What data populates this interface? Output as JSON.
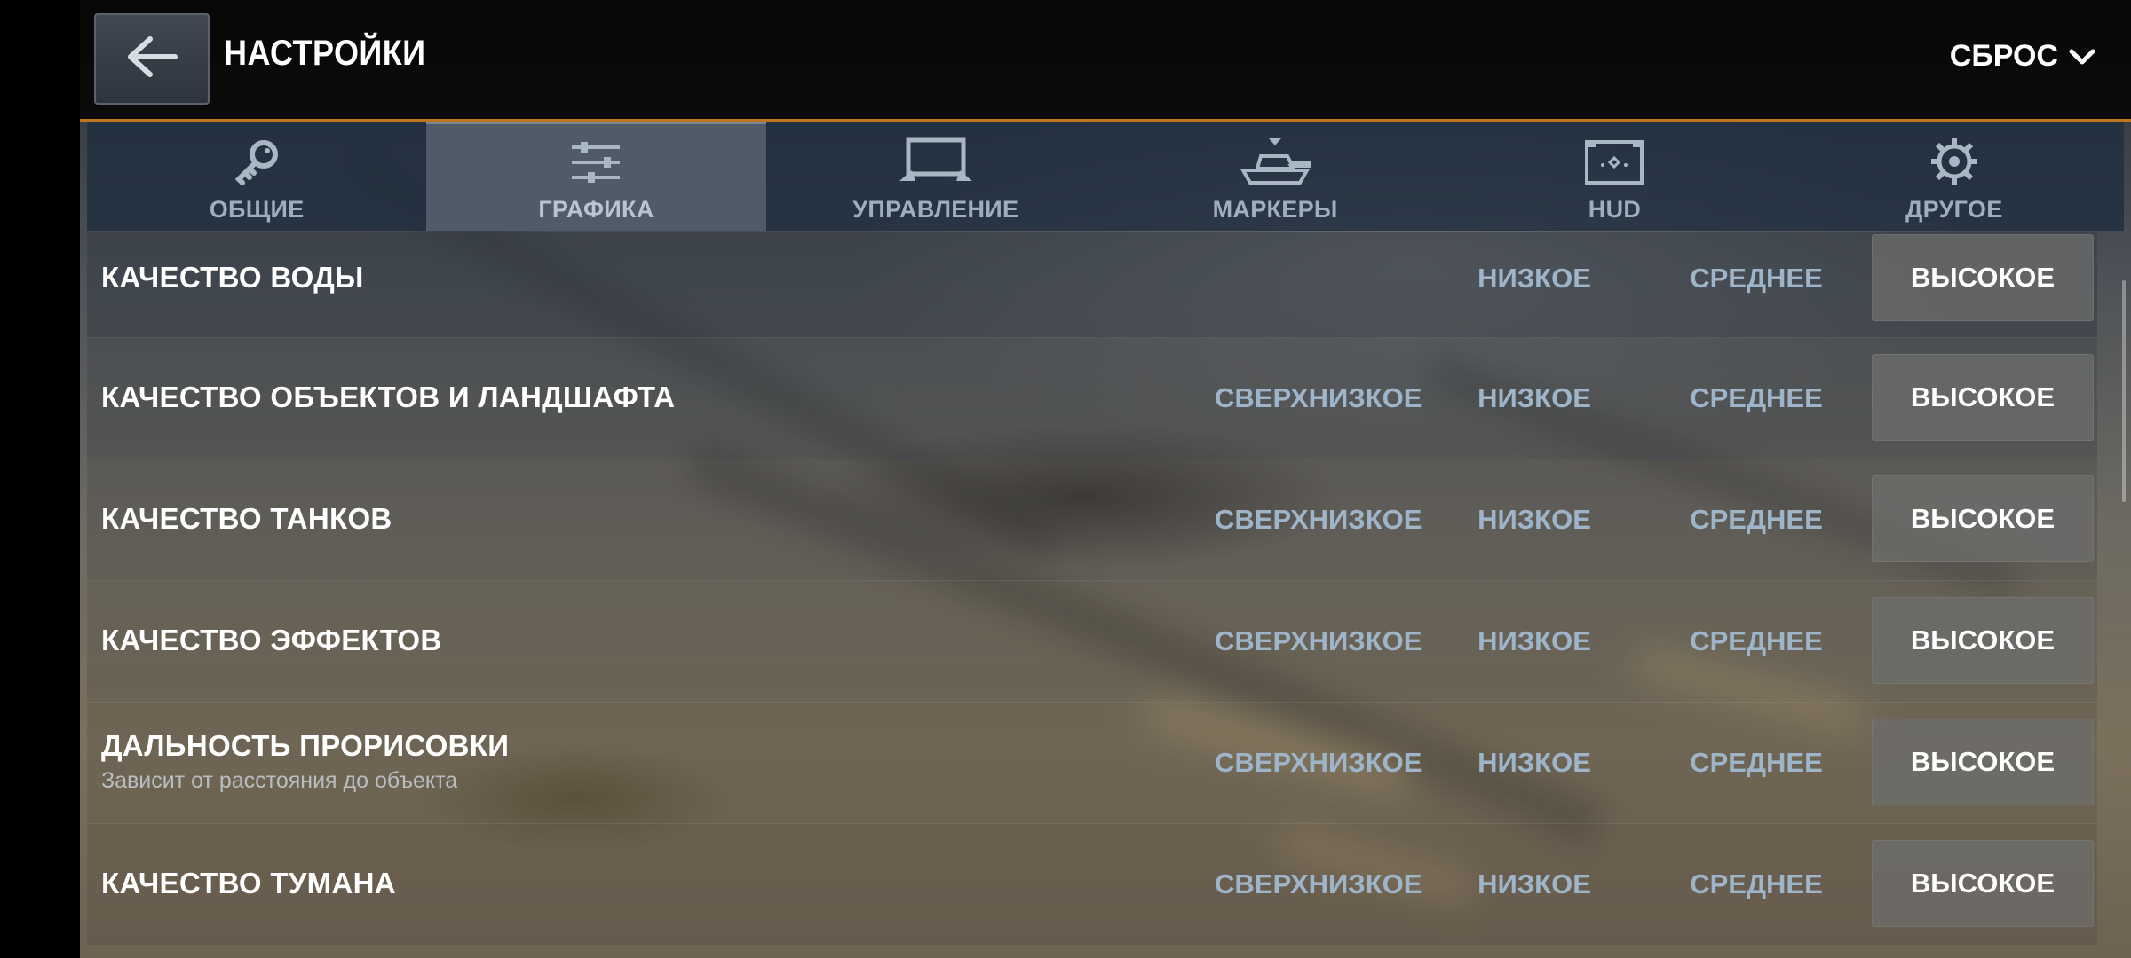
{
  "header": {
    "title": "НАСТРОЙКИ",
    "reset_label": "СБРОС",
    "accent_color": "#c0741c"
  },
  "tabs": [
    {
      "label": "ОБЩИЕ",
      "icon": "key-icon",
      "active": false
    },
    {
      "label": "ГРАФИКА",
      "icon": "sliders-icon",
      "active": true
    },
    {
      "label": "УПРАВЛЕНИЕ",
      "icon": "controller-icon",
      "active": false
    },
    {
      "label": "МАРКЕРЫ",
      "icon": "tank-marker-icon",
      "active": false
    },
    {
      "label": "HUD",
      "icon": "hud-screen-icon",
      "active": false
    },
    {
      "label": "ДРУГОЕ",
      "icon": "gear-icon",
      "active": false
    }
  ],
  "rows": [
    {
      "label": "КАЧЕСТВО ВОДЫ",
      "options": [
        "НИЗКОЕ",
        "СРЕДНЕЕ",
        "ВЫСОКОЕ"
      ],
      "selected": "ВЫСОКОЕ"
    },
    {
      "label": "КАЧЕСТВО ОБЪЕКТОВ И ЛАНДШАФТА",
      "options": [
        "СВЕРХНИЗКОЕ",
        "НИЗКОЕ",
        "СРЕДНЕЕ",
        "ВЫСОКОЕ"
      ],
      "selected": "ВЫСОКОЕ"
    },
    {
      "label": "КАЧЕСТВО ТАНКОВ",
      "options": [
        "СВЕРХНИЗКОЕ",
        "НИЗКОЕ",
        "СРЕДНЕЕ",
        "ВЫСОКОЕ"
      ],
      "selected": "ВЫСОКОЕ"
    },
    {
      "label": "КАЧЕСТВО ЭФФЕКТОВ",
      "options": [
        "СВЕРХНИЗКОЕ",
        "НИЗКОЕ",
        "СРЕДНЕЕ",
        "ВЫСОКОЕ"
      ],
      "selected": "ВЫСОКОЕ"
    },
    {
      "label": "ДАЛЬНОСТЬ ПРОРИСОВКИ",
      "sub": "Зависит от расстояния до объекта",
      "options": [
        "СВЕРХНИЗКОЕ",
        "НИЗКОЕ",
        "СРЕДНЕЕ",
        "ВЫСОКОЕ"
      ],
      "selected": "ВЫСОКОЕ"
    },
    {
      "label": "КАЧЕСТВО ТУМАНА",
      "options": [
        "СВЕРХНИЗКОЕ",
        "НИЗКОЕ",
        "СРЕДНЕЕ",
        "ВЫСОКОЕ"
      ],
      "selected": "ВЫСОКОЕ"
    }
  ]
}
